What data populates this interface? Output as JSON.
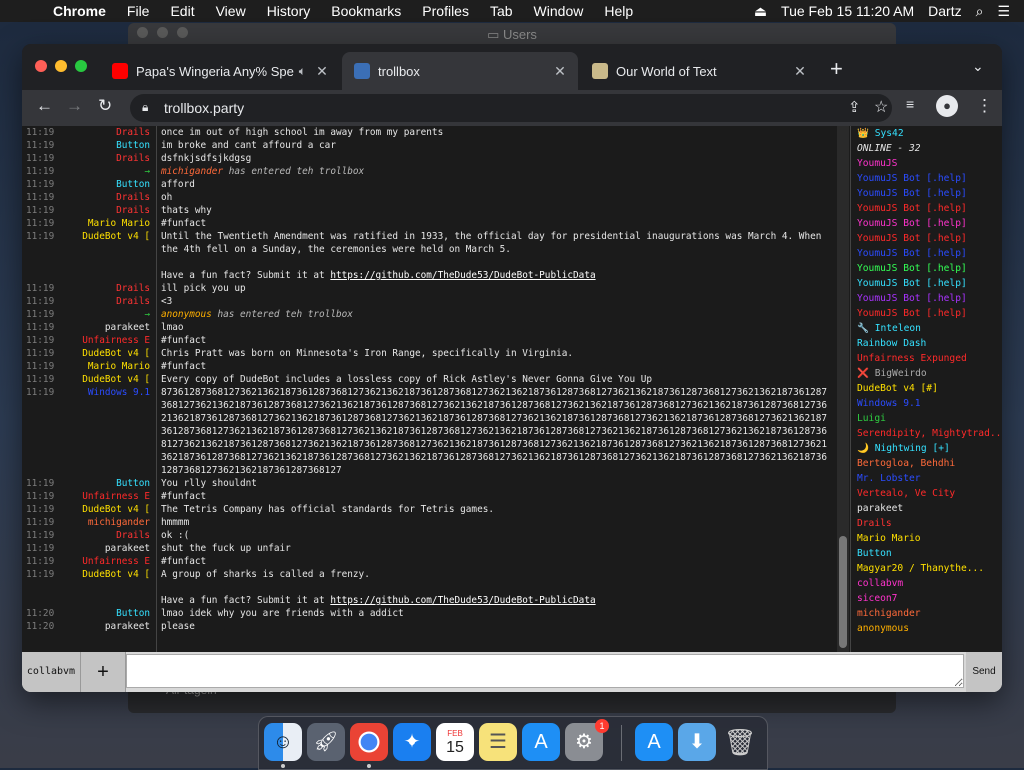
{
  "menubar": {
    "app": "Chrome",
    "items": [
      "File",
      "Edit",
      "View",
      "History",
      "Bookmarks",
      "Profiles",
      "Tab",
      "Window",
      "Help"
    ],
    "clock": "Tue Feb 15  11:20 AM",
    "user": "Dartz"
  },
  "background_window": {
    "title": "Users",
    "bottom_text": "Air tagein"
  },
  "tabs": [
    {
      "title": "Papa's Wingeria Any% Spe",
      "favicon_color": "#ff0000"
    },
    {
      "title": "trollbox",
      "favicon_color": "#3b6fb6"
    },
    {
      "title": "Our World of Text",
      "favicon_color": "#c9b98a"
    }
  ],
  "address": {
    "url": "trollbox.party"
  },
  "chat": [
    {
      "time": "11:19",
      "nick": "Drails",
      "color": "#ff3333",
      "text": "once im out of high school im away from my parents"
    },
    {
      "time": "11:19",
      "nick": "Button",
      "color": "#35e1ff",
      "text": "im broke and cant affourd a car"
    },
    {
      "time": "11:19",
      "nick": "Drails",
      "color": "#ff3333",
      "text": "dsfnkjsdfsjkdgsg"
    },
    {
      "time": "11:19",
      "nick": "→",
      "color": "#2ecc40",
      "system": true,
      "who": "michigander",
      "who_color": "#ff6a3a",
      "text": "has entered teh trollbox"
    },
    {
      "time": "11:19",
      "nick": "Button",
      "color": "#35e1ff",
      "text": "afford"
    },
    {
      "time": "11:19",
      "nick": "Drails",
      "color": "#ff3333",
      "text": "oh"
    },
    {
      "time": "11:19",
      "nick": "Drails",
      "color": "#ff3333",
      "text": "thats why"
    },
    {
      "time": "11:19",
      "nick": "Mario Mario",
      "color": "#ffe000",
      "text": "#funfact"
    },
    {
      "time": "11:19",
      "nick": "DudeBot v4 [",
      "color": "#ffe000",
      "text": "Until the Twentieth Amendment was ratified in 1933, the official day for presidential inaugurations was March 4. When the 4th fell on a Sunday, the ceremonies were held on March 5.\n\nHave a fun fact? Submit it at ",
      "link": "https://github.com/TheDude53/DudeBot-PublicData"
    },
    {
      "time": "11:19",
      "nick": "Drails",
      "color": "#ff3333",
      "text": "ill pick you up"
    },
    {
      "time": "11:19",
      "nick": "Drails",
      "color": "#ff3333",
      "text": "<3"
    },
    {
      "time": "11:19",
      "nick": "→",
      "color": "#2ecc40",
      "system": true,
      "who": "anonymous",
      "who_color": "#ffb000",
      "text": "has entered teh trollbox"
    },
    {
      "time": "11:19",
      "nick": "parakeet",
      "color": "#e6e6e6",
      "text": "lmao"
    },
    {
      "time": "11:19",
      "nick": "Unfairness E",
      "color": "#ff2a2a",
      "text": "#funfact"
    },
    {
      "time": "11:19",
      "nick": "DudeBot v4 [",
      "color": "#ffe000",
      "text": "Chris Pratt was born on Minnesota's Iron Range, specifically in Virginia."
    },
    {
      "time": "11:19",
      "nick": "Mario Mario",
      "color": "#ffe000",
      "text": "#funfact"
    },
    {
      "time": "11:19",
      "nick": "DudeBot v4 [",
      "color": "#ffe000",
      "text": "Every copy of DudeBot includes a lossless copy of Rick Astley's Never Gonna Give You Up"
    },
    {
      "time": "11:19",
      "nick": "Windows 9.1",
      "color": "#2b4cff",
      "text": "87361287368127362136218736128736812736213621873612873681273621362187361287368127362136218736128736812736213621873612873681273621362187361287368127362136218736128736812736213621873612873681273621362187361287368127362136218736128736812736213621873612873681273621362187361287368127362136218736128736812736213621873612873681273621362187361287368127362136218736128736812736213621873612873681273621362187361287368127362136218736128736812736213621873612873681273621362187361287368127362136218736128736812736213621873612873681273621362187361287368127362136218736128736812736213621873612873681273621362187361287368127362136218736128736812736213621873612873681273621362187361287368127362136218736128736812736213621873612873681273621362187361287368127"
    },
    {
      "time": "11:19",
      "nick": "Button",
      "color": "#35e1ff",
      "text": "You rlly shouldnt"
    },
    {
      "time": "11:19",
      "nick": "Unfairness E",
      "color": "#ff2a2a",
      "text": "#funfact"
    },
    {
      "time": "11:19",
      "nick": "DudeBot v4 [",
      "color": "#ffe000",
      "text": "The Tetris Company has official standards for Tetris games."
    },
    {
      "time": "11:19",
      "nick": "michigander",
      "color": "#ff6a3a",
      "text": "hmmmm"
    },
    {
      "time": "11:19",
      "nick": "Drails",
      "color": "#ff3333",
      "text": "ok :("
    },
    {
      "time": "11:19",
      "nick": "parakeet",
      "color": "#e6e6e6",
      "text": "shut the fuck up unfair"
    },
    {
      "time": "11:19",
      "nick": "Unfairness E",
      "color": "#ff2a2a",
      "text": "#funfact"
    },
    {
      "time": "11:19",
      "nick": "DudeBot v4 [",
      "color": "#ffe000",
      "text": "A group of sharks is called a frenzy.\n\nHave a fun fact? Submit it at ",
      "link": "https://github.com/TheDude53/DudeBot-PublicData"
    },
    {
      "time": "11:20",
      "nick": "Button",
      "color": "#35e1ff",
      "text": "lmao idek why you are friends with a addict"
    },
    {
      "time": "11:20",
      "nick": "parakeet",
      "color": "#e6e6e6",
      "text": "please"
    }
  ],
  "users": [
    {
      "name": "👑 Sys42",
      "color": "#35e1ff"
    },
    {
      "name": "ONLINE - 32",
      "color": "#e6e6e6",
      "online": true
    },
    {
      "name": "YoumuJS",
      "color": "#ff33cc"
    },
    {
      "name": "YoumuJS Bot [.help]",
      "color": "#2b4cff"
    },
    {
      "name": "YoumuJS Bot [.help]",
      "color": "#2b4cff"
    },
    {
      "name": "YoumuJS Bot [.help]",
      "color": "#ff2a2a"
    },
    {
      "name": "YoumuJS Bot [.help]",
      "color": "#ff33cc"
    },
    {
      "name": "YoumuJS Bot [.help]",
      "color": "#ff2a2a"
    },
    {
      "name": "YoumuJS Bot [.help]",
      "color": "#2b4cff"
    },
    {
      "name": "YoumuJS Bot [.help]",
      "color": "#33ff55"
    },
    {
      "name": "YoumuJS Bot [.help]",
      "color": "#35e1ff"
    },
    {
      "name": "YoumuJS Bot [.help]",
      "color": "#aa33ff"
    },
    {
      "name": "YoumuJS Bot [.help]",
      "color": "#ff2a2a"
    },
    {
      "name": "🔧 Inteleon",
      "color": "#35e1ff"
    },
    {
      "name": "Rainbow Dash",
      "color": "#35e1ff"
    },
    {
      "name": "Unfairness Expunged",
      "color": "#ff2a2a"
    },
    {
      "name": "❌ BigWeirdo",
      "color": "#aaaaaa"
    },
    {
      "name": "DudeBot v4 [#]",
      "color": "#ffe000"
    },
    {
      "name": "Windows 9.1",
      "color": "#2b4cff"
    },
    {
      "name": "Luigi",
      "color": "#2ecc40"
    },
    {
      "name": "Serendipity, Mightytrad...",
      "color": "#ff2a2a"
    },
    {
      "name": "🌙 Nightwing [+]",
      "color": "#35e1ff"
    },
    {
      "name": "Bertogloa, Behdhi",
      "color": "#ff6a3a"
    },
    {
      "name": "Mr. Lobster",
      "color": "#2b4cff"
    },
    {
      "name": "Vertealo, Ve City",
      "color": "#ff2a2a"
    },
    {
      "name": "parakeet",
      "color": "#e6e6e6"
    },
    {
      "name": "Drails",
      "color": "#ff3333"
    },
    {
      "name": "Mario Mario",
      "color": "#ffe000"
    },
    {
      "name": "Button",
      "color": "#35e1ff"
    },
    {
      "name": "Magyar20 / Thanythe...",
      "color": "#ffe000"
    },
    {
      "name": "collabvm",
      "color": "#ff33cc"
    },
    {
      "name": "siceon7",
      "color": "#ff33cc"
    },
    {
      "name": "michigander",
      "color": "#ff6a3a"
    },
    {
      "name": "anonymous",
      "color": "#ffb000"
    }
  ],
  "input": {
    "room_label": "collabvm",
    "add_label": "+",
    "send_label": "Send",
    "placeholder": ""
  },
  "dock": {
    "calendar_month": "FEB",
    "calendar_day": "15",
    "badge": "1"
  }
}
